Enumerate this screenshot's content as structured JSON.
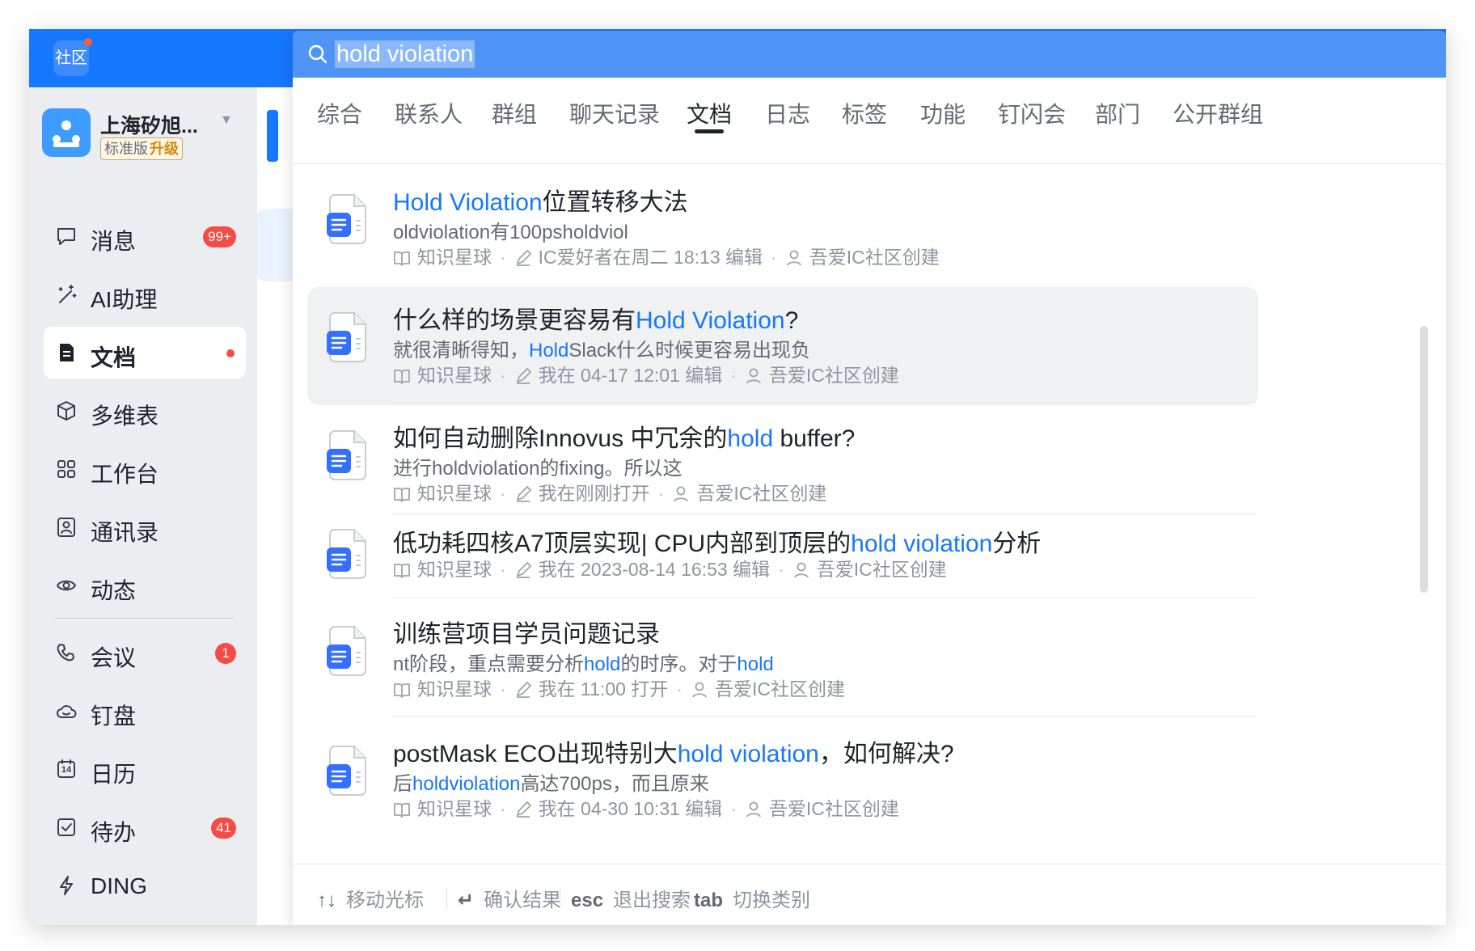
{
  "app": {
    "logo_text": "社区",
    "accent_color": "#1677ff"
  },
  "org": {
    "name": "上海矽旭...",
    "plan_label": "标准版",
    "upgrade_label": "升级"
  },
  "nav": {
    "items": [
      {
        "label": "消息",
        "icon": "message-icon",
        "badge": "99+"
      },
      {
        "label": "AI助理",
        "icon": "ai-wand-icon"
      },
      {
        "label": "文档",
        "icon": "document-icon",
        "active": true,
        "dot": true
      },
      {
        "label": "多维表",
        "icon": "cube-icon"
      },
      {
        "label": "工作台",
        "icon": "grid-icon"
      },
      {
        "label": "通讯录",
        "icon": "contacts-icon"
      },
      {
        "label": "动态",
        "icon": "eye-icon"
      },
      {
        "label": "会议",
        "icon": "phone-icon",
        "badge": "1"
      },
      {
        "label": "钉盘",
        "icon": "cloud-icon"
      },
      {
        "label": "日历",
        "icon": "calendar-icon",
        "calendar_day": "14"
      },
      {
        "label": "待办",
        "icon": "todo-check-icon",
        "badge": "41"
      },
      {
        "label": "DING",
        "icon": "lightning-icon"
      }
    ]
  },
  "search": {
    "query": "hold violation"
  },
  "tabs": [
    "综合",
    "联系人",
    "群组",
    "聊天记录",
    "文档",
    "日志",
    "标签",
    "功能",
    "钉闪会",
    "部门",
    "公开群组"
  ],
  "active_tab": "文档",
  "results": [
    {
      "title": [
        {
          "t": "Hold Violation",
          "hl": true
        },
        {
          "t": "位置转移大法"
        }
      ],
      "snippet": [
        {
          "t": "oldviolation有100psholdviol"
        }
      ],
      "source": "知识星球",
      "edit": "IC爱好者在周二 18:13 编辑",
      "creator": "吾爱IC社区创建"
    },
    {
      "title": [
        {
          "t": "什么样的场景更容易有"
        },
        {
          "t": "Hold Violation",
          "hl": true
        },
        {
          "t": "?"
        }
      ],
      "snippet": [
        {
          "t": "就很清晰得知，"
        },
        {
          "t": "Hold",
          "hl": true
        },
        {
          "t": "Slack什么时候更容易出现负"
        }
      ],
      "source": "知识星球",
      "edit": "我在 04-17 12:01 编辑",
      "creator": "吾爱IC社区创建"
    },
    {
      "title": [
        {
          "t": "如何自动删除Innovus 中冗余的"
        },
        {
          "t": "hold",
          "hl": true
        },
        {
          "t": " buffer?"
        }
      ],
      "snippet": [
        {
          "t": "进行holdviolation的fixing。所以这"
        }
      ],
      "source": "知识星球",
      "edit": "我在刚刚打开",
      "creator": "吾爱IC社区创建"
    },
    {
      "title": [
        {
          "t": "低功耗四核A7顶层实现| CPU内部到顶层的"
        },
        {
          "t": "hold violation",
          "hl": true
        },
        {
          "t": "分析"
        }
      ],
      "snippet": [],
      "source": "知识星球",
      "edit": "我在 2023-08-14 16:53 编辑",
      "creator": "吾爱IC社区创建"
    },
    {
      "title": [
        {
          "t": "训练营项目学员问题记录"
        }
      ],
      "snippet": [
        {
          "t": "nt阶段，重点需要分析"
        },
        {
          "t": "hold",
          "hl": true
        },
        {
          "t": "的时序。对于"
        },
        {
          "t": "hold",
          "hl": true
        }
      ],
      "source": "知识星球",
      "edit": "我在 11:00 打开",
      "creator": "吾爱IC社区创建"
    },
    {
      "title": [
        {
          "t": "postMask ECO出现特别大"
        },
        {
          "t": "hold violation",
          "hl": true
        },
        {
          "t": "，如何解决?"
        }
      ],
      "snippet": [
        {
          "t": "后"
        },
        {
          "t": "holdviolation",
          "hl": true
        },
        {
          "t": "高达700ps，而且原来"
        }
      ],
      "source": "知识星球",
      "edit": "我在 04-30 10:31 编辑",
      "creator": "吾爱IC社区创建"
    }
  ],
  "footer": [
    {
      "key": "↑↓",
      "label": "移动光标"
    },
    {
      "key": "↵",
      "label": "确认结果"
    },
    {
      "key": "esc",
      "label": "退出搜索"
    },
    {
      "key": "tab",
      "label": "切换类别"
    }
  ]
}
